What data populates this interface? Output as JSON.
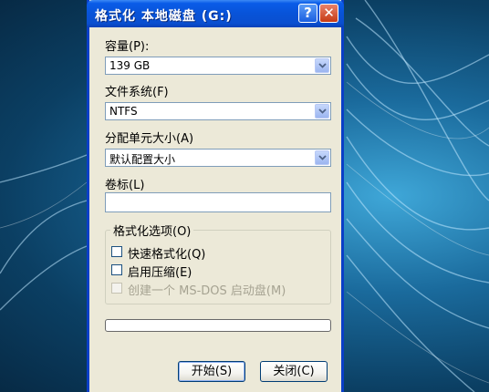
{
  "window": {
    "title": "格式化 本地磁盘 (G:)",
    "help_label": "?",
    "close_label": "✕"
  },
  "capacity": {
    "label": "容量(P):",
    "value": "139 GB"
  },
  "filesystem": {
    "label": "文件系统(F)",
    "value": "NTFS"
  },
  "allocation": {
    "label": "分配单元大小(A)",
    "value": "默认配置大小"
  },
  "volume_label": {
    "label": "卷标(L)",
    "value": ""
  },
  "format_options": {
    "title": "格式化选项(O)",
    "quick_format": {
      "label": "快速格式化(Q)",
      "checked": false
    },
    "compression": {
      "label": "启用压缩(E)",
      "checked": false
    },
    "msdos_disk": {
      "label": "创建一个 MS-DOS 启动盘(M)",
      "checked": false,
      "disabled": true
    }
  },
  "progress": {
    "value": 0
  },
  "buttons": {
    "start": "开始(S)",
    "close": "关闭(C)"
  },
  "icons": {
    "dropdown": "chevron-down-icon",
    "help": "help-icon",
    "close": "close-icon"
  }
}
